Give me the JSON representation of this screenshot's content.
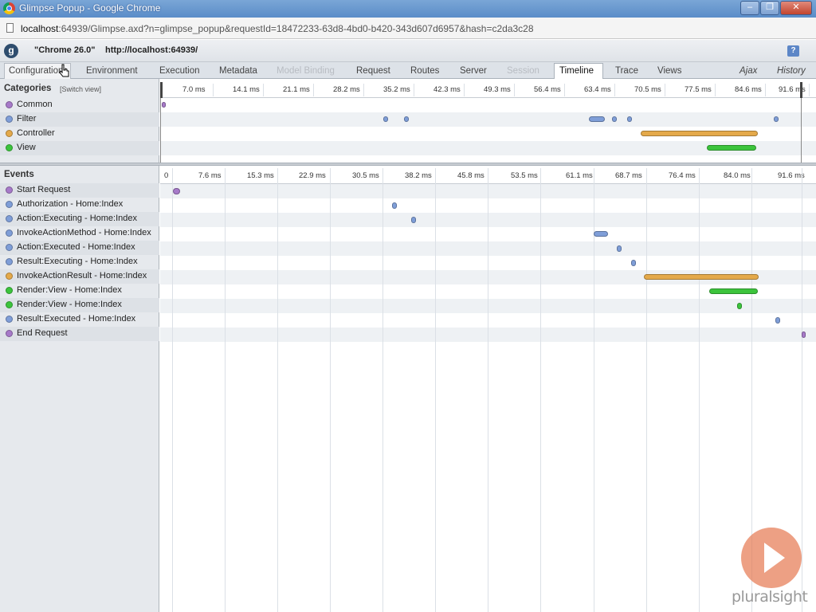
{
  "window": {
    "title": "Glimpse Popup - Google Chrome"
  },
  "address": {
    "host": "localhost",
    "rest": ":64939/Glimpse.axd?n=glimpse_popup&requestId=18472233-63d8-4bd0-b420-343d607d6957&hash=c2da3c28"
  },
  "glimpse": {
    "environment": "\"Chrome 26.0\"",
    "url": "http://localhost:64939/",
    "help": "?",
    "tabs": [
      {
        "label": "Configuration",
        "state": "hover"
      },
      {
        "label": "Environment",
        "state": "normal"
      },
      {
        "label": "Execution",
        "state": "normal"
      },
      {
        "label": "Metadata",
        "state": "normal"
      },
      {
        "label": "Model Binding",
        "state": "disabled"
      },
      {
        "label": "Request",
        "state": "normal"
      },
      {
        "label": "Routes",
        "state": "normal"
      },
      {
        "label": "Server",
        "state": "normal"
      },
      {
        "label": "Session",
        "state": "disabled"
      },
      {
        "label": "Timeline",
        "state": "active"
      },
      {
        "label": "Trace",
        "state": "normal"
      },
      {
        "label": "Views",
        "state": "normal"
      },
      {
        "label": "Ajax",
        "state": "italic"
      },
      {
        "label": "History",
        "state": "italic"
      }
    ]
  },
  "categories": {
    "heading": "Categories",
    "switch_view": "[Switch view]",
    "axis_ticks": [
      "7.0 ms",
      "14.1 ms",
      "21.1 ms",
      "28.2 ms",
      "35.2 ms",
      "42.3 ms",
      "49.3 ms",
      "56.4 ms",
      "63.4 ms",
      "70.5 ms",
      "77.5 ms",
      "84.6 ms",
      "91.6 ms"
    ],
    "items": [
      {
        "label": "Common",
        "color": "#a77ac9"
      },
      {
        "label": "Filter",
        "color": "#7f9ed8"
      },
      {
        "label": "Controller",
        "color": "#e4a94a"
      },
      {
        "label": "View",
        "color": "#3cc43c"
      }
    ]
  },
  "events": {
    "heading": "Events",
    "axis_ticks": [
      "0",
      "7.6 ms",
      "15.3 ms",
      "22.9 ms",
      "30.5 ms",
      "38.2 ms",
      "45.8 ms",
      "53.5 ms",
      "61.1 ms",
      "68.7 ms",
      "76.4 ms",
      "84.0 ms",
      "91.6 ms"
    ],
    "items": [
      {
        "label": "Start Request",
        "category": "Common"
      },
      {
        "label": "Authorization - Home:Index",
        "category": "Filter"
      },
      {
        "label": "Action:Executing - Home:Index",
        "category": "Filter"
      },
      {
        "label": "InvokeActionMethod - Home:Index",
        "category": "Filter"
      },
      {
        "label": "Action:Executed - Home:Index",
        "category": "Filter"
      },
      {
        "label": "Result:Executing - Home:Index",
        "category": "Filter"
      },
      {
        "label": "InvokeActionResult - Home:Index",
        "category": "Controller"
      },
      {
        "label": "Render:View - Home:Index",
        "category": "View"
      },
      {
        "label": "Render:View - Home:Index",
        "category": "View"
      },
      {
        "label": "Result:Executed - Home:Index",
        "category": "Filter"
      },
      {
        "label": "End Request",
        "category": "Common"
      }
    ]
  },
  "watermark": {
    "brand": "pluralsight"
  }
}
